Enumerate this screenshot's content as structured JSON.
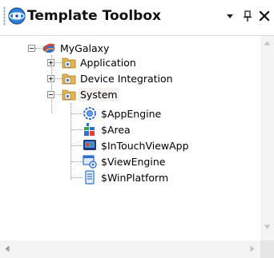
{
  "panel": {
    "title": "Template Toolbox",
    "title_icon": "toolbox-icon",
    "buttons": [
      "dropdown-menu-icon",
      "pin-icon",
      "close-icon"
    ]
  },
  "tree": {
    "root": {
      "label": "MyGalaxy",
      "icon": "galaxy-icon",
      "expanded": true
    },
    "folders": [
      {
        "label": "Application",
        "icon": "template-folder-icon",
        "expanded": false
      },
      {
        "label": "Device Integration",
        "icon": "template-folder-icon",
        "expanded": false
      },
      {
        "label": "System",
        "icon": "template-folder-icon",
        "expanded": true,
        "selected": true
      }
    ],
    "system_items": [
      {
        "label": "$AppEngine",
        "icon": "app-engine-icon"
      },
      {
        "label": "$Area",
        "icon": "area-icon"
      },
      {
        "label": "$InTouchViewApp",
        "icon": "intouch-view-app-icon"
      },
      {
        "label": "$ViewEngine",
        "icon": "view-engine-icon"
      },
      {
        "label": "$WinPlatform",
        "icon": "win-platform-icon"
      }
    ]
  },
  "colors": {
    "selection_bg": "#f4f0ee",
    "folder": "#d9a63a",
    "scrollbar": "#f4f4f4"
  }
}
